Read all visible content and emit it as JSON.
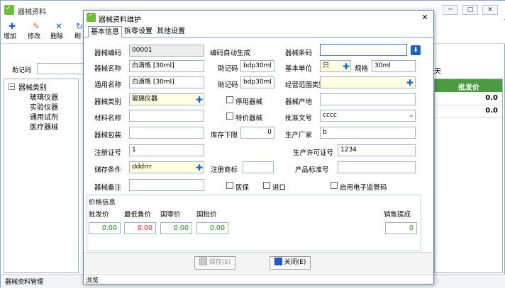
{
  "main_window": {
    "title": "器械资料",
    "controls": [
      "─",
      "□",
      "✕"
    ],
    "toolbar": [
      {
        "icon": "add-icon",
        "label": "增加"
      },
      {
        "icon": "edit-icon",
        "label": "修改"
      },
      {
        "icon": "delete-icon",
        "label": "删除"
      },
      {
        "icon": "refresh-icon",
        "label": "刷"
      }
    ],
    "search_label": "助记码",
    "search_value": "",
    "right_truncated_text": "天",
    "tree": {
      "expander": "−",
      "root": "器械类别",
      "children": [
        "玻璃仪器",
        "实验仪器",
        "通用试剂",
        "医疗器械"
      ]
    },
    "grid": {
      "header": "批发价",
      "values": [
        "0.0",
        "0.0"
      ]
    },
    "status": "器械资料管理"
  },
  "dialog": {
    "title": "器械资料维护",
    "close": "✕",
    "tabs": [
      "基本信息",
      "拆零设置",
      "其他设置"
    ],
    "form": {
      "code_label": "器械编码",
      "code_value": "00001",
      "auto_code_label": "编码自动生成",
      "barcode_label": "器械条码",
      "barcode_value": "",
      "name_label": "器械名称",
      "name_value": "白滴瓶 [30ml]",
      "name_mnemonic_label": "助记码",
      "name_mnemonic_value": "bdp30ml",
      "unit_label": "基本单位",
      "unit_value": "只",
      "spec_label": "规格",
      "spec_value": "30ml",
      "common_name_label": "通用名称",
      "common_name_value": "白滴瓶 [30ml]",
      "common_mnemonic_label": "助记码",
      "common_mnemonic_value": "bdp30ml",
      "scope_label": "经营范围类别",
      "scope_value": "",
      "category_label": "器械类别",
      "category_value": "玻璃仪器",
      "disabled_label": "停用器械",
      "origin_label": "器械产地",
      "origin_value": "",
      "material_label": "材料名称",
      "material_value": "",
      "special_price_label": "特价器械",
      "approval_label": "批准文号",
      "approval_value": "cccc",
      "package_label": "器械包装",
      "package_value": "",
      "min_stock_label": "库存下限",
      "min_stock_value": "0",
      "manufacturer_label": "生产厂家",
      "manufacturer_value": "b",
      "reg_cert_label": "注册证号",
      "reg_cert_value": "1",
      "license_label": "生产许可证号",
      "license_value": "1234",
      "storage_label": "储存条件",
      "storage_value": "dddrrr",
      "trademark_label": "注册商标",
      "trademark_value": "",
      "standard_label": "产品标准号",
      "standard_value": "",
      "remark_label": "器械备注",
      "remark_value": "",
      "medical_insurance_label": "医保",
      "import_label": "进口",
      "e_supervision_label": "启用电子监管码"
    },
    "price": {
      "section_label": "价格信息",
      "wholesale_label": "批发价",
      "wholesale_value": "0.00",
      "min_retail_label": "最低售价",
      "min_retail_value": "0.00",
      "national_retail_label": "国零价",
      "national_retail_value": "0.00",
      "national_wholesale_label": "国批价",
      "national_wholesale_value": "0.00",
      "commission_label": "销售提成",
      "commission_value": "0"
    },
    "buttons": {
      "save": "保存(S)",
      "close": "关闭(E)"
    },
    "status": "浏览"
  }
}
